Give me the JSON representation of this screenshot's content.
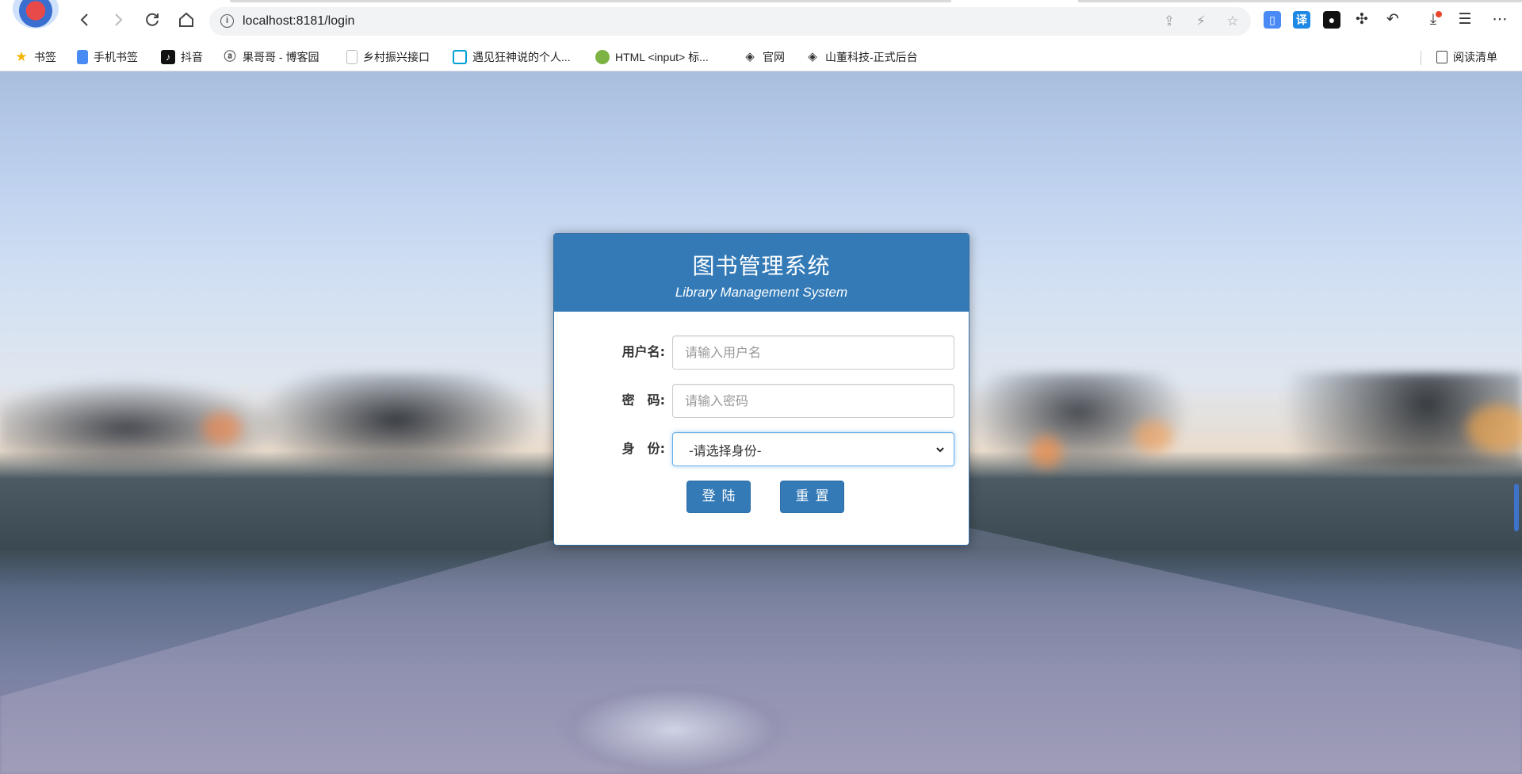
{
  "browser": {
    "url": "localhost:8181/login",
    "bookmarks": [
      {
        "label": "书签",
        "icon": "star-icon",
        "color": "#f4b400"
      },
      {
        "label": "手机书签",
        "icon": "phone-bookmark-icon",
        "color": "#4a8af4"
      },
      {
        "label": "抖音",
        "icon": "douyin-icon",
        "color": "#111111"
      },
      {
        "label": "果哥哥 - 博客园",
        "icon": "cnblogs-icon",
        "color": "#555555"
      },
      {
        "label": "乡村振兴接口",
        "icon": "page-icon",
        "color": "#bbbbbb"
      },
      {
        "label": "遇见狂神说的个人...",
        "icon": "bilibili-icon",
        "color": "#00a1d6"
      },
      {
        "label": "HTML <input> 标...",
        "icon": "runoob-icon",
        "color": "#7cb342"
      },
      {
        "label": "官网",
        "icon": "logo-icon",
        "color": "#333333"
      },
      {
        "label": "山董科技-正式后台",
        "icon": "logo-icon",
        "color": "#333333"
      }
    ],
    "reading_list": "阅读清单",
    "extensions": [
      {
        "name": "mouse-extension-icon",
        "color": "#4a8af4",
        "glyph": "▯"
      },
      {
        "name": "translate-extension-icon",
        "color": "#1e88e5",
        "glyph": "译"
      },
      {
        "name": "mask-extension-icon",
        "color": "#111111",
        "glyph": "●"
      }
    ]
  },
  "login": {
    "title": "图书管理系统",
    "subtitle": "Library Management System",
    "username_label": "用户名:",
    "username_placeholder": "请输入用户名",
    "password_label": "密　码:",
    "password_placeholder": "请输入密码",
    "role_label": "身　份:",
    "role_selected": "-请选择身份-",
    "login_button": "登陆",
    "reset_button": "重置"
  },
  "colors": {
    "primary": "#337ab7",
    "focus": "#66afe9"
  }
}
